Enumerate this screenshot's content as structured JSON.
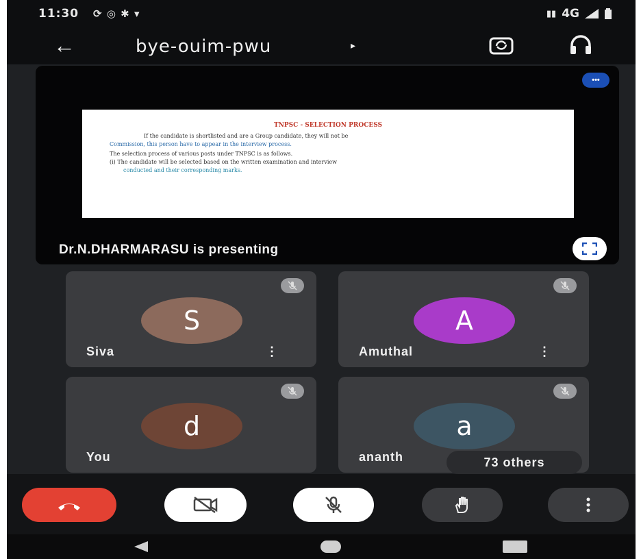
{
  "status_bar": {
    "time": "11:30",
    "left_icons": "⟳ ◎ ✱ ▾",
    "network": "4G"
  },
  "toolbar": {
    "back_icon": "arrow-left-icon",
    "meeting_code": "bye-ouim-pwu",
    "caret": "▸"
  },
  "presentation": {
    "slide_title": "TNPSC - SELECTION PROCESS",
    "slide_lines": [
      "If the candidate is shortlisted and are a Group candidate, they will not be",
      "Commission, this person have to appear in the interview process.",
      "The selection process of various posts under TNPSC is as follows.",
      "(i) The candidate will be selected based on the written examination and interview",
      "conducted and their corresponding marks."
    ],
    "presenting_text": "Dr.N.DHARMARASU is presenting"
  },
  "participants": [
    {
      "name": "Siva",
      "initial": "S",
      "color": "#8c6a5c",
      "has_menu": true
    },
    {
      "name": "Amuthal",
      "initial": "A",
      "color": "#a93bc9",
      "has_menu": true
    },
    {
      "name": "You",
      "initial": "d",
      "color": "#6e4536",
      "has_menu": false
    },
    {
      "name": "ananth",
      "initial": "a",
      "color": "#3d5563",
      "has_menu": false
    }
  ],
  "others_chip": "73 others",
  "controls": {
    "end_call_color": "#e34133",
    "buttons": [
      "end-call",
      "camera-off",
      "mic-off",
      "raise-hand",
      "more-options"
    ]
  },
  "colors": {
    "background": "#1f2124",
    "tile": "#3b3c3f",
    "accent_blue": "#1b4fb5"
  }
}
